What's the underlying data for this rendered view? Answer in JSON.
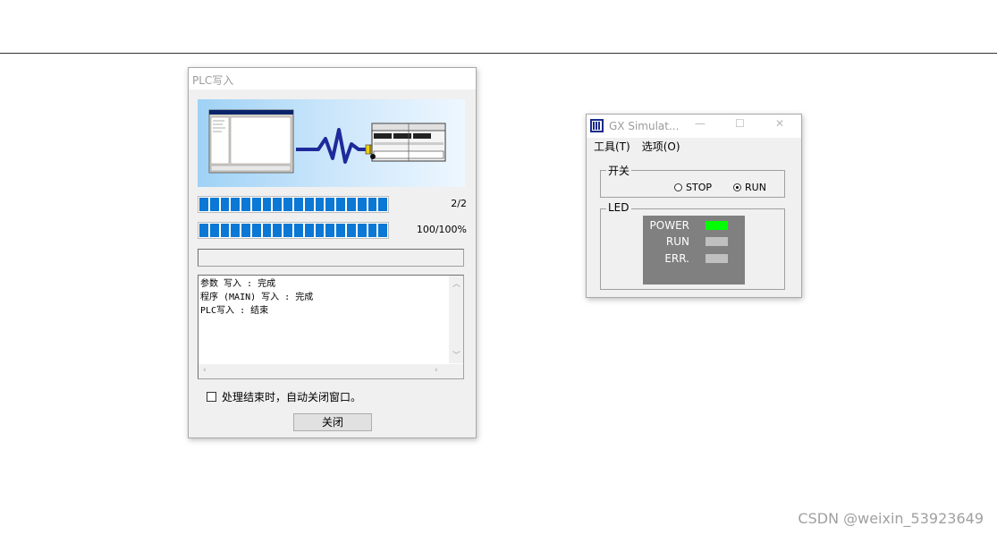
{
  "plc_dialog": {
    "title": "PLC写入",
    "progress_1": {
      "label": "2/2",
      "fraction": 1.0
    },
    "progress_2": {
      "label": "100/100%",
      "fraction": 1.0
    },
    "log_lines": [
      "参数 写入 : 完成",
      "程序 (MAIN) 写入 : 完成",
      "PLC写入 : 结束"
    ],
    "auto_close_label": "处理结束时，自动关闭窗口。",
    "auto_close_checked": false,
    "close_button_label": "关闭"
  },
  "gx_simulator": {
    "title": "GX Simulat...",
    "menu": [
      "工具(T)",
      "选项(O)"
    ],
    "switch_group": {
      "label": "开关",
      "options": [
        "STOP",
        "RUN"
      ],
      "selected": "RUN"
    },
    "led_group": {
      "label": "LED",
      "leds": [
        {
          "name": "POWER",
          "on": true,
          "color": "#00ff00"
        },
        {
          "name": "RUN",
          "on": false,
          "color": "#c0c0c0"
        },
        {
          "name": "ERR.",
          "on": false,
          "color": "#c0c0c0"
        }
      ]
    }
  },
  "watermark": "CSDN @weixin_53923649"
}
